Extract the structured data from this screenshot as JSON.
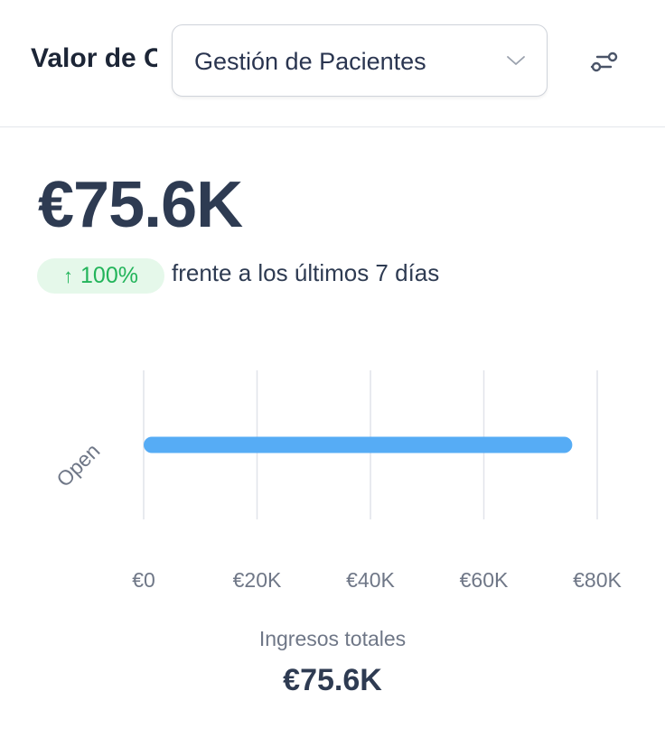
{
  "header": {
    "title": "Valor de Oportunidades",
    "select_value": "Gestión de Pacientes"
  },
  "icons": {
    "select": "chevron-down-icon",
    "filter": "sliders-icon",
    "trend": "arrow-up-icon"
  },
  "metric": {
    "value": "€75.6K",
    "change": "100%",
    "comparison": "frente a los últimos 7 días"
  },
  "colors": {
    "bar": "#56acf5",
    "positive": "#22b45a",
    "positive_bg": "#e5f8ea"
  },
  "chart_data": {
    "type": "bar",
    "orientation": "horizontal",
    "categories": [
      "Open"
    ],
    "values": [
      75600
    ],
    "xlim": [
      0,
      80000
    ],
    "xticks": [
      0,
      20000,
      40000,
      60000,
      80000
    ],
    "xtick_labels": [
      "€0",
      "€20K",
      "€40K",
      "€60K",
      "€80K"
    ],
    "grid": true
  },
  "footer": {
    "label": "Ingresos totales",
    "value": "€75.6K"
  }
}
